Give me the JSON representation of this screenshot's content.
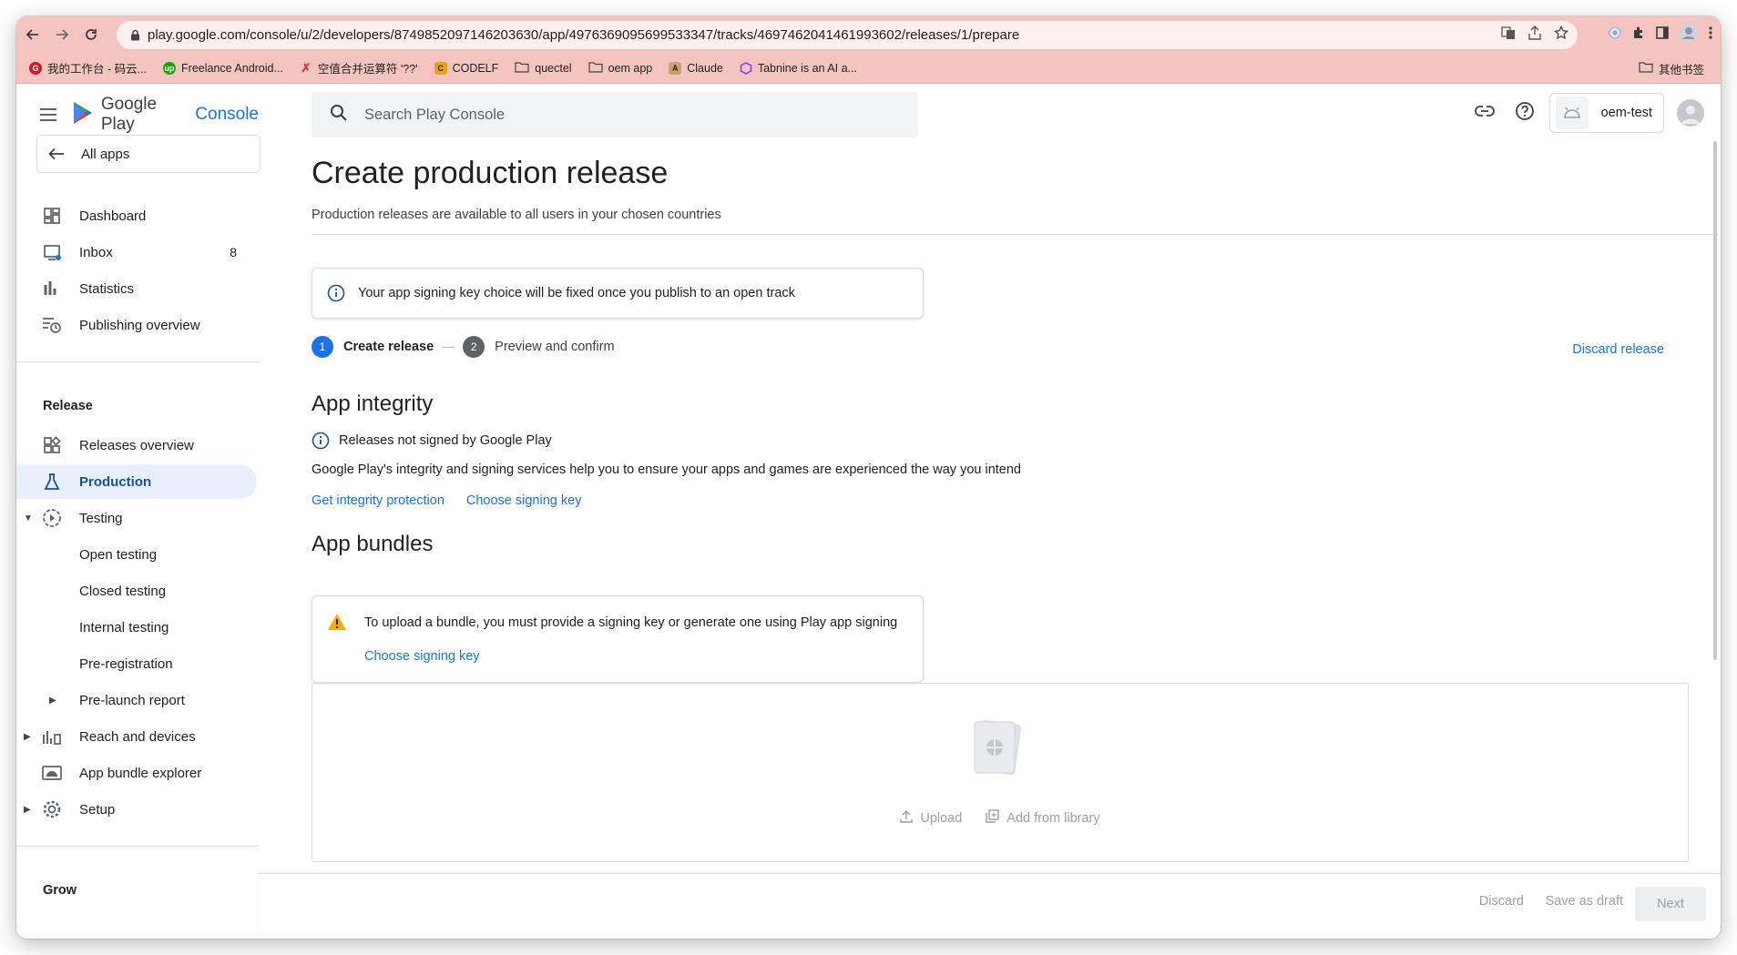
{
  "browser": {
    "url": "play.google.com/console/u/2/developers/8749852097146203630/app/4976369095699533347/tracks/4697462041461993602/releases/1/prepare",
    "bookmarks": [
      {
        "label": "我的工作台 - 码云...",
        "color": "#c71d23",
        "icon": "gitee-icon"
      },
      {
        "label": "Freelance Android...",
        "color": "#14a800",
        "icon": "upwork-icon"
      },
      {
        "label": "空值合并运算符 '??'",
        "color": "#d33",
        "icon": "pin-icon"
      },
      {
        "label": "CODELF",
        "color": "#e8a317",
        "icon": "codelf-icon"
      },
      {
        "label": "quectel",
        "color": "",
        "icon": "folder-icon"
      },
      {
        "label": "oem app",
        "color": "",
        "icon": "folder-icon"
      },
      {
        "label": "Claude",
        "color": "#c9a26b",
        "icon": "claude-icon"
      },
      {
        "label": "Tabnine is an AI a...",
        "color": "#7b3fe4",
        "icon": "tabnine-icon"
      }
    ],
    "other_bookmarks": "其他书签"
  },
  "brand": {
    "title_a": "Google Play",
    "title_b": "Console"
  },
  "sidebar": {
    "all_apps": "All apps",
    "items_top": [
      {
        "label": "Dashboard",
        "icon": "dashboard-icon"
      },
      {
        "label": "Inbox",
        "icon": "inbox-icon",
        "badge": "8"
      },
      {
        "label": "Statistics",
        "icon": "statistics-icon"
      },
      {
        "label": "Publishing overview",
        "icon": "publishing-overview-icon"
      }
    ],
    "release_title": "Release",
    "release_items": [
      {
        "label": "Releases overview",
        "icon": "releases-overview-icon"
      },
      {
        "label": "Production",
        "icon": "production-icon"
      },
      {
        "label": "Testing",
        "icon": "testing-icon"
      },
      {
        "label": "Open testing"
      },
      {
        "label": "Closed testing"
      },
      {
        "label": "Internal testing"
      },
      {
        "label": "Pre-registration"
      },
      {
        "label": "Pre-launch report"
      },
      {
        "label": "Reach and devices",
        "icon": "reach-devices-icon"
      },
      {
        "label": "App bundle explorer",
        "icon": "app-bundle-explorer-icon"
      },
      {
        "label": "Setup",
        "icon": "gear-icon"
      }
    ],
    "grow_title": "Grow"
  },
  "header": {
    "search_placeholder": "Search Play Console",
    "account_name": "oem-test"
  },
  "main": {
    "title": "Create production release",
    "subtitle": "Production releases are available to all users in your chosen countries",
    "notice": "Your app signing key choice will be fixed once you publish to an open track",
    "steps": [
      {
        "num": "1",
        "label": "Create release",
        "color": "#1a73e8"
      },
      {
        "num": "2",
        "label": "Preview and confirm",
        "color": "#5f6368"
      }
    ],
    "discard_release": "Discard release",
    "integrity": {
      "title": "App integrity",
      "status": "Releases not signed by Google Play",
      "description": "Google Play's integrity and signing services help you to ensure your apps and games are experienced the way you intend",
      "link_protection": "Get integrity protection",
      "link_signing": "Choose signing key"
    },
    "bundles": {
      "title": "App bundles",
      "warning": "To upload a bundle, you must provide a signing key or generate one using Play app signing",
      "warning_link": "Choose signing key",
      "upload": "Upload",
      "add_from_library": "Add from library"
    }
  },
  "footer": {
    "discard": "Discard",
    "save_draft": "Save as draft",
    "next": "Next"
  },
  "colors": {
    "accent": "#1a73e8",
    "warning": "#f9ab00",
    "chrome": "#f3c4c0"
  }
}
